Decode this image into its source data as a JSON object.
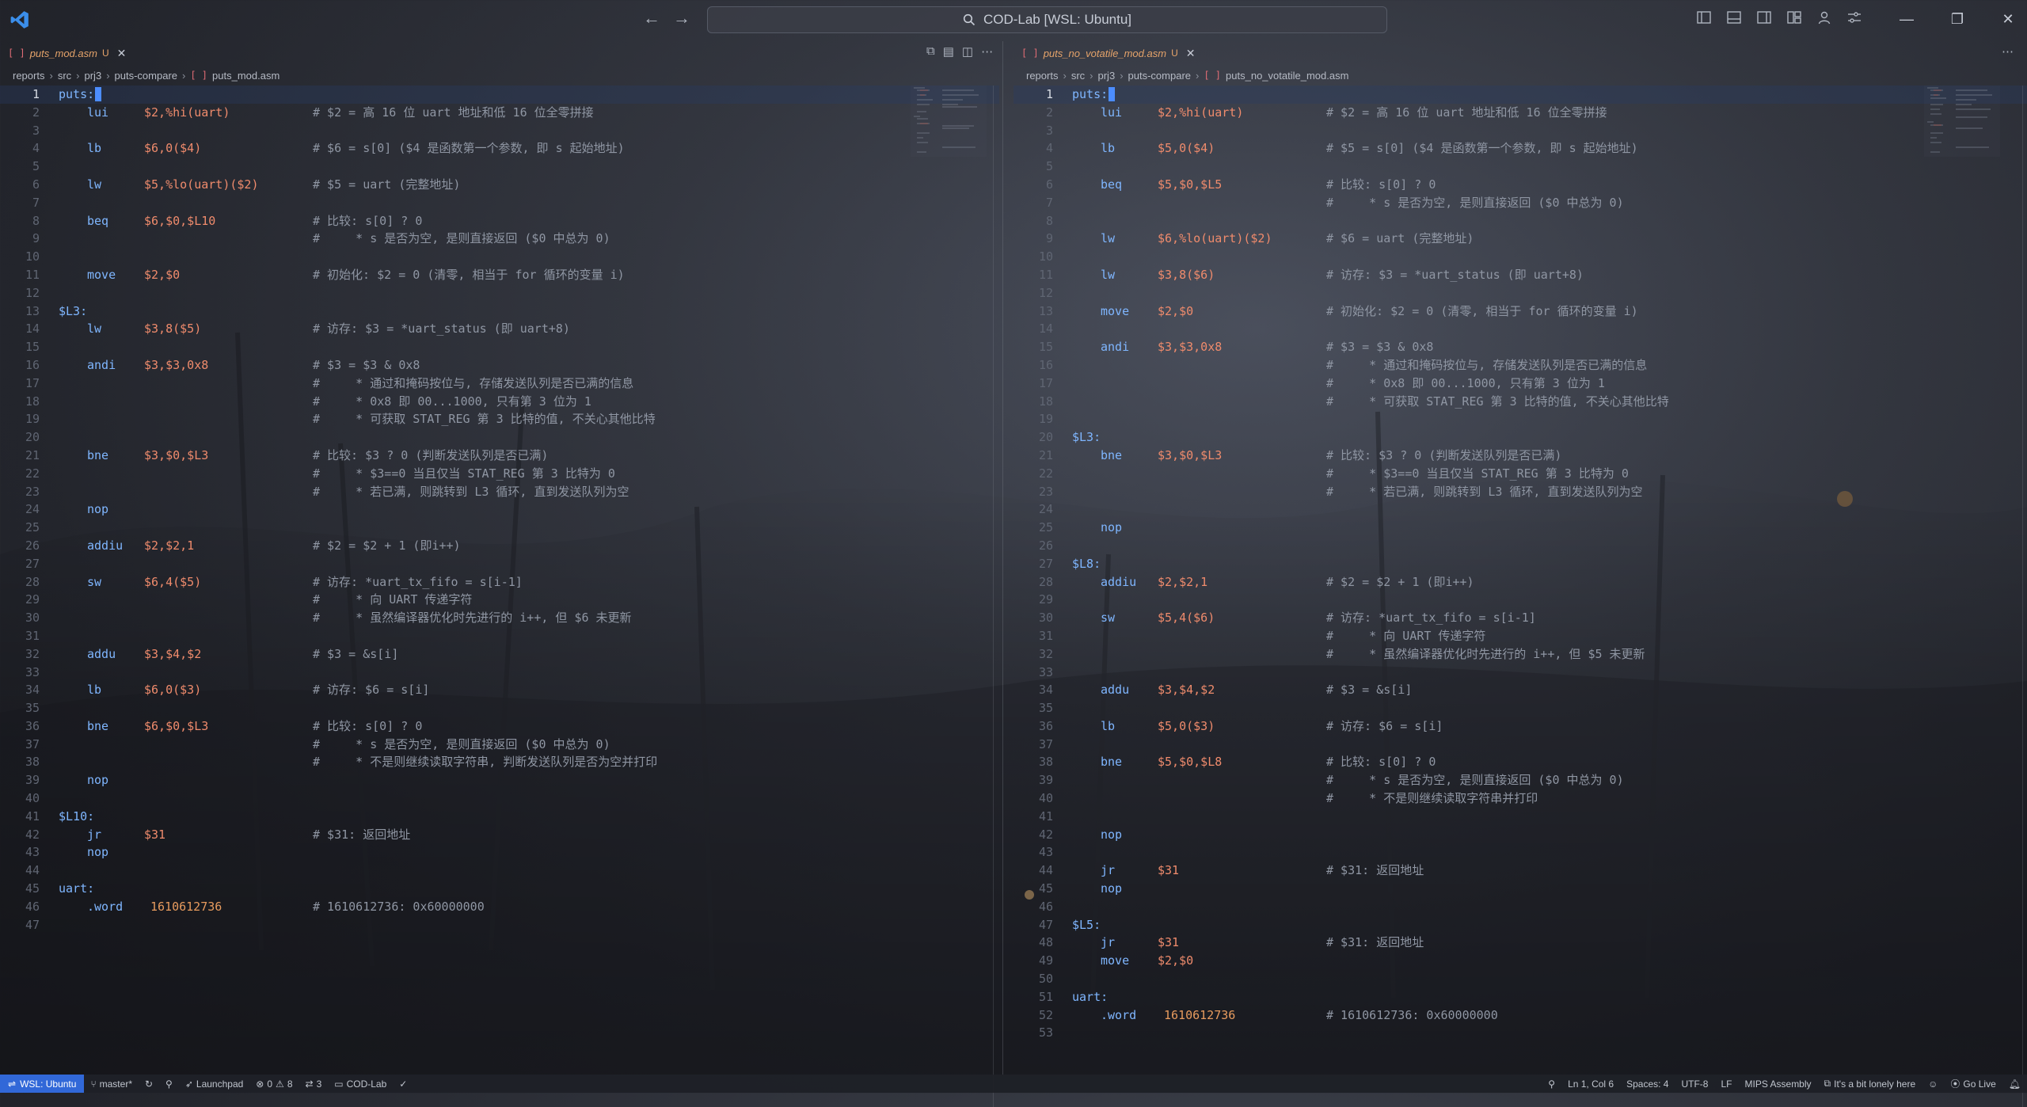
{
  "window": {
    "command_center": "COD-Lab [WSL: Ubuntu]"
  },
  "left": {
    "tab": {
      "name": "puts_mod.asm",
      "badge": "U"
    },
    "breadcrumb": [
      "reports",
      "src",
      "prj3",
      "puts-compare",
      "puts_mod.asm"
    ],
    "lines": [
      {
        "lbl": "puts:",
        "op": "",
        "args": "",
        "cmt": ""
      },
      {
        "lbl": "",
        "op": "lui",
        "args": "$2,%hi(uart)",
        "cmt": "# $2 = 高 16 位 uart 地址和低 16 位全零拼接"
      },
      {
        "lbl": "",
        "op": "",
        "args": "",
        "cmt": ""
      },
      {
        "lbl": "",
        "op": "lb",
        "args": "$6,0($4)",
        "cmt": "# $6 = s[0] ($4 是函数第一个参数, 即 s 起始地址)"
      },
      {
        "lbl": "",
        "op": "",
        "args": "",
        "cmt": ""
      },
      {
        "lbl": "",
        "op": "lw",
        "args": "$5,%lo(uart)($2)",
        "cmt": "# $5 = uart (完整地址)"
      },
      {
        "lbl": "",
        "op": "",
        "args": "",
        "cmt": ""
      },
      {
        "lbl": "",
        "op": "beq",
        "args": "$6,$0,$L10",
        "cmt": "# 比较: s[0] ? 0"
      },
      {
        "lbl": "",
        "op": "",
        "args": "",
        "cmt": "#     * s 是否为空, 是则直接返回 ($0 中总为 0)"
      },
      {
        "lbl": "",
        "op": "",
        "args": "",
        "cmt": ""
      },
      {
        "lbl": "",
        "op": "move",
        "args": "$2,$0",
        "cmt": "# 初始化: $2 = 0 (清零, 相当于 for 循环的变量 i)"
      },
      {
        "lbl": "",
        "op": "",
        "args": "",
        "cmt": ""
      },
      {
        "lbl": "$L3:",
        "op": "",
        "args": "",
        "cmt": ""
      },
      {
        "lbl": "",
        "op": "lw",
        "args": "$3,8($5)",
        "cmt": "# 访存: $3 = *uart_status (即 uart+8)"
      },
      {
        "lbl": "",
        "op": "",
        "args": "",
        "cmt": ""
      },
      {
        "lbl": "",
        "op": "andi",
        "args": "$3,$3,0x8",
        "cmt": "# $3 = $3 & 0x8"
      },
      {
        "lbl": "",
        "op": "",
        "args": "",
        "cmt": "#     * 通过和掩码按位与, 存储发送队列是否已满的信息"
      },
      {
        "lbl": "",
        "op": "",
        "args": "",
        "cmt": "#     * 0x8 即 00...1000, 只有第 3 位为 1"
      },
      {
        "lbl": "",
        "op": "",
        "args": "",
        "cmt": "#     * 可获取 STAT_REG 第 3 比特的值, 不关心其他比特"
      },
      {
        "lbl": "",
        "op": "",
        "args": "",
        "cmt": ""
      },
      {
        "lbl": "",
        "op": "bne",
        "args": "$3,$0,$L3",
        "cmt": "# 比较: $3 ? 0 (判断发送队列是否已满)"
      },
      {
        "lbl": "",
        "op": "",
        "args": "",
        "cmt": "#     * $3==0 当且仅当 STAT_REG 第 3 比特为 0"
      },
      {
        "lbl": "",
        "op": "",
        "args": "",
        "cmt": "#     * 若已满, 则跳转到 L3 循环, 直到发送队列为空"
      },
      {
        "lbl": "",
        "op": "nop",
        "args": "",
        "cmt": ""
      },
      {
        "lbl": "",
        "op": "",
        "args": "",
        "cmt": ""
      },
      {
        "lbl": "",
        "op": "addiu",
        "args": "$2,$2,1",
        "cmt": "# $2 = $2 + 1 (即i++)"
      },
      {
        "lbl": "",
        "op": "",
        "args": "",
        "cmt": ""
      },
      {
        "lbl": "",
        "op": "sw",
        "args": "$6,4($5)",
        "cmt": "# 访存: *uart_tx_fifo = s[i-1]"
      },
      {
        "lbl": "",
        "op": "",
        "args": "",
        "cmt": "#     * 向 UART 传递字符"
      },
      {
        "lbl": "",
        "op": "",
        "args": "",
        "cmt": "#     * 虽然编译器优化时先进行的 i++, 但 $6 未更新"
      },
      {
        "lbl": "",
        "op": "",
        "args": "",
        "cmt": ""
      },
      {
        "lbl": "",
        "op": "addu",
        "args": "$3,$4,$2",
        "cmt": "# $3 = &s[i]"
      },
      {
        "lbl": "",
        "op": "",
        "args": "",
        "cmt": ""
      },
      {
        "lbl": "",
        "op": "lb",
        "args": "$6,0($3)",
        "cmt": "# 访存: $6 = s[i]"
      },
      {
        "lbl": "",
        "op": "",
        "args": "",
        "cmt": ""
      },
      {
        "lbl": "",
        "op": "bne",
        "args": "$6,$0,$L3",
        "cmt": "# 比较: s[0] ? 0"
      },
      {
        "lbl": "",
        "op": "",
        "args": "",
        "cmt": "#     * s 是否为空, 是则直接返回 ($0 中总为 0)"
      },
      {
        "lbl": "",
        "op": "",
        "args": "",
        "cmt": "#     * 不是则继续读取字符串, 判断发送队列是否为空并打印"
      },
      {
        "lbl": "",
        "op": "nop",
        "args": "",
        "cmt": ""
      },
      {
        "lbl": "",
        "op": "",
        "args": "",
        "cmt": ""
      },
      {
        "lbl": "$L10:",
        "op": "",
        "args": "",
        "cmt": ""
      },
      {
        "lbl": "",
        "op": "jr",
        "args": "$31",
        "cmt": "# $31: 返回地址"
      },
      {
        "lbl": "",
        "op": "nop",
        "args": "",
        "cmt": ""
      },
      {
        "lbl": "",
        "op": "",
        "args": "",
        "cmt": ""
      },
      {
        "lbl": "uart:",
        "op": "",
        "args": "",
        "cmt": ""
      },
      {
        "lbl": "",
        "op": ".word",
        "args": "1610612736",
        "cmt": "# 1610612736: 0x60000000"
      },
      {
        "lbl": "",
        "op": "",
        "args": "",
        "cmt": ""
      }
    ]
  },
  "right": {
    "tab": {
      "name": "puts_no_votatile_mod.asm",
      "badge": "U"
    },
    "breadcrumb": [
      "reports",
      "src",
      "prj3",
      "puts-compare",
      "puts_no_votatile_mod.asm"
    ],
    "lines": [
      {
        "lbl": "puts:",
        "op": "",
        "args": "",
        "cmt": ""
      },
      {
        "lbl": "",
        "op": "lui",
        "args": "$2,%hi(uart)",
        "cmt": "# $2 = 高 16 位 uart 地址和低 16 位全零拼接"
      },
      {
        "lbl": "",
        "op": "",
        "args": "",
        "cmt": ""
      },
      {
        "lbl": "",
        "op": "lb",
        "args": "$5,0($4)",
        "cmt": "# $5 = s[0] ($4 是函数第一个参数, 即 s 起始地址)"
      },
      {
        "lbl": "",
        "op": "",
        "args": "",
        "cmt": ""
      },
      {
        "lbl": "",
        "op": "beq",
        "args": "$5,$0,$L5",
        "cmt": "# 比较: s[0] ? 0"
      },
      {
        "lbl": "",
        "op": "",
        "args": "",
        "cmt": "#     * s 是否为空, 是则直接返回 ($0 中总为 0)"
      },
      {
        "lbl": "",
        "op": "",
        "args": "",
        "cmt": ""
      },
      {
        "lbl": "",
        "op": "lw",
        "args": "$6,%lo(uart)($2)",
        "cmt": "# $6 = uart (完整地址)"
      },
      {
        "lbl": "",
        "op": "",
        "args": "",
        "cmt": ""
      },
      {
        "lbl": "",
        "op": "lw",
        "args": "$3,8($6)",
        "cmt": "# 访存: $3 = *uart_status (即 uart+8)"
      },
      {
        "lbl": "",
        "op": "",
        "args": "",
        "cmt": ""
      },
      {
        "lbl": "",
        "op": "move",
        "args": "$2,$0",
        "cmt": "# 初始化: $2 = 0 (清零, 相当于 for 循环的变量 i)"
      },
      {
        "lbl": "",
        "op": "",
        "args": "",
        "cmt": ""
      },
      {
        "lbl": "",
        "op": "andi",
        "args": "$3,$3,0x8",
        "cmt": "# $3 = $3 & 0x8"
      },
      {
        "lbl": "",
        "op": "",
        "args": "",
        "cmt": "#     * 通过和掩码按位与, 存储发送队列是否已满的信息"
      },
      {
        "lbl": "",
        "op": "",
        "args": "",
        "cmt": "#     * 0x8 即 00...1000, 只有第 3 位为 1"
      },
      {
        "lbl": "",
        "op": "",
        "args": "",
        "cmt": "#     * 可获取 STAT_REG 第 3 比特的值, 不关心其他比特"
      },
      {
        "lbl": "",
        "op": "",
        "args": "",
        "cmt": ""
      },
      {
        "lbl": "$L3:",
        "op": "",
        "args": "",
        "cmt": ""
      },
      {
        "lbl": "",
        "op": "bne",
        "args": "$3,$0,$L3",
        "cmt": "# 比较: $3 ? 0 (判断发送队列是否已满)"
      },
      {
        "lbl": "",
        "op": "",
        "args": "",
        "cmt": "#     * $3==0 当且仅当 STAT_REG 第 3 比特为 0"
      },
      {
        "lbl": "",
        "op": "",
        "args": "",
        "cmt": "#     * 若已满, 则跳转到 L3 循环, 直到发送队列为空"
      },
      {
        "lbl": "",
        "op": "",
        "args": "",
        "cmt": ""
      },
      {
        "lbl": "",
        "op": "nop",
        "args": "",
        "cmt": ""
      },
      {
        "lbl": "",
        "op": "",
        "args": "",
        "cmt": ""
      },
      {
        "lbl": "$L8:",
        "op": "",
        "args": "",
        "cmt": ""
      },
      {
        "lbl": "",
        "op": "addiu",
        "args": "$2,$2,1",
        "cmt": "# $2 = $2 + 1 (即i++)"
      },
      {
        "lbl": "",
        "op": "",
        "args": "",
        "cmt": ""
      },
      {
        "lbl": "",
        "op": "sw",
        "args": "$5,4($6)",
        "cmt": "# 访存: *uart_tx_fifo = s[i-1]"
      },
      {
        "lbl": "",
        "op": "",
        "args": "",
        "cmt": "#     * 向 UART 传递字符"
      },
      {
        "lbl": "",
        "op": "",
        "args": "",
        "cmt": "#     * 虽然编译器优化时先进行的 i++, 但 $5 未更新"
      },
      {
        "lbl": "",
        "op": "",
        "args": "",
        "cmt": ""
      },
      {
        "lbl": "",
        "op": "addu",
        "args": "$3,$4,$2",
        "cmt": "# $3 = &s[i]"
      },
      {
        "lbl": "",
        "op": "",
        "args": "",
        "cmt": ""
      },
      {
        "lbl": "",
        "op": "lb",
        "args": "$5,0($3)",
        "cmt": "# 访存: $6 = s[i]"
      },
      {
        "lbl": "",
        "op": "",
        "args": "",
        "cmt": ""
      },
      {
        "lbl": "",
        "op": "bne",
        "args": "$5,$0,$L8",
        "cmt": "# 比较: s[0] ? 0"
      },
      {
        "lbl": "",
        "op": "",
        "args": "",
        "cmt": "#     * s 是否为空, 是则直接返回 ($0 中总为 0)"
      },
      {
        "lbl": "",
        "op": "",
        "args": "",
        "cmt": "#     * 不是则继续读取字符串并打印"
      },
      {
        "lbl": "",
        "op": "",
        "args": "",
        "cmt": ""
      },
      {
        "lbl": "",
        "op": "nop",
        "args": "",
        "cmt": ""
      },
      {
        "lbl": "",
        "op": "",
        "args": "",
        "cmt": ""
      },
      {
        "lbl": "",
        "op": "jr",
        "args": "$31",
        "cmt": "# $31: 返回地址"
      },
      {
        "lbl": "",
        "op": "nop",
        "args": "",
        "cmt": ""
      },
      {
        "lbl": "",
        "op": "",
        "args": "",
        "cmt": ""
      },
      {
        "lbl": "$L5:",
        "op": "",
        "args": "",
        "cmt": ""
      },
      {
        "lbl": "",
        "op": "jr",
        "args": "$31",
        "cmt": "# $31: 返回地址"
      },
      {
        "lbl": "",
        "op": "move",
        "args": "$2,$0",
        "cmt": ""
      },
      {
        "lbl": "",
        "op": "",
        "args": "",
        "cmt": ""
      },
      {
        "lbl": "uart:",
        "op": "",
        "args": "",
        "cmt": ""
      },
      {
        "lbl": "",
        "op": ".word",
        "args": "1610612736",
        "cmt": "# 1610612736: 0x60000000"
      },
      {
        "lbl": "",
        "op": "",
        "args": "",
        "cmt": ""
      }
    ]
  },
  "statusbar": {
    "remote": "WSL: Ubuntu",
    "branch": "master*",
    "launchpad": "Launchpad",
    "errors": "0",
    "warnings": "8",
    "ports": "3",
    "workspace": "COD-Lab",
    "position": "Ln 1, Col 6",
    "spaces": "Spaces: 4",
    "encoding": "UTF-8",
    "eol": "LF",
    "language": "MIPS Assembly",
    "message": "It's a bit lonely here",
    "golive": "Go Live"
  },
  "colors": {
    "accent": "#3168d8",
    "label": "#7fb6ff",
    "register": "#ef8b6c",
    "comment": "#8f96a3",
    "tab_modified": "#e5a36a"
  },
  "icons": [
    "vscode-logo",
    "back-arrow-icon",
    "forward-arrow-icon",
    "search-icon",
    "toggle-primary-sidebar-icon",
    "toggle-panel-icon",
    "toggle-secondary-sidebar-icon",
    "customize-layout-icon",
    "accounts-icon",
    "settings-icon",
    "minimize-icon",
    "maximize-icon",
    "close-icon",
    "asm-file-icon",
    "split-editor-icon",
    "more-actions-icon"
  ]
}
